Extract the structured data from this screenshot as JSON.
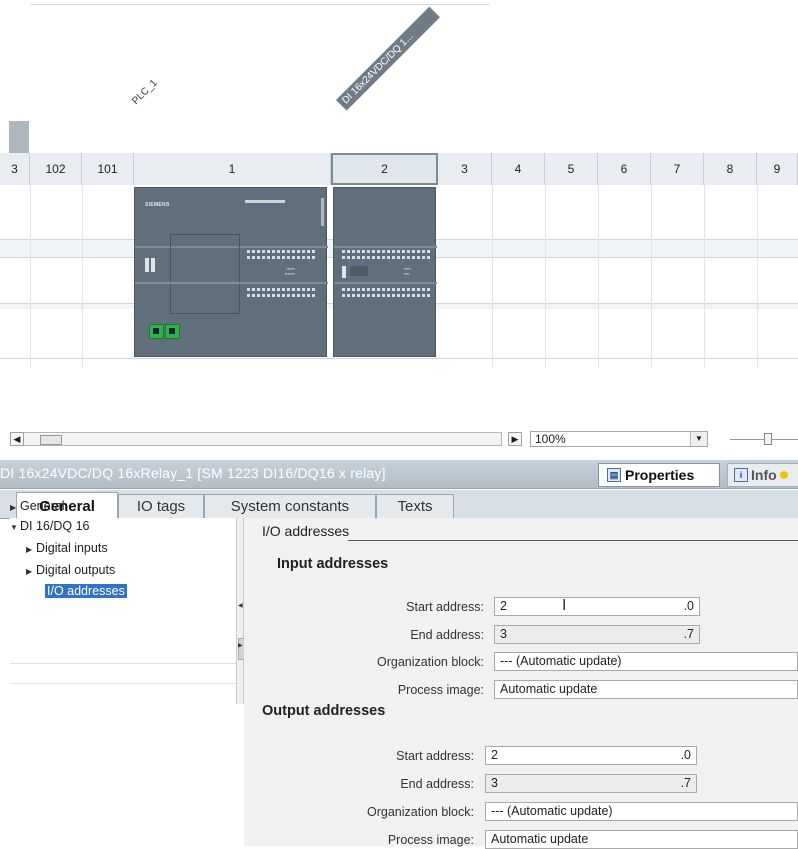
{
  "device_view": {
    "labels": {
      "plc": "PLC_1",
      "module": "DI 16x24VDC/DQ 1..."
    },
    "slots": [
      "3",
      "102",
      "101",
      "1",
      "2",
      "3",
      "4",
      "5",
      "6",
      "7",
      "8",
      "9"
    ],
    "selected_slot": "2"
  },
  "toolbar": {
    "zoom": "100%",
    "scroll_left_icon": "arrow-left-icon",
    "scroll_right_icon": "arrow-right-icon"
  },
  "inspector": {
    "title": "DI 16x24VDC/DQ 16xRelay_1 [SM 1223 DI16/DQ16 x relay]",
    "properties_tab": "Properties",
    "info_tab": "Info",
    "tabs": [
      "General",
      "IO tags",
      "System constants",
      "Texts"
    ],
    "active_tab": "General"
  },
  "tree": {
    "items": [
      {
        "label": "General",
        "level": 0,
        "expanded": false
      },
      {
        "label": "DI 16/DQ 16",
        "level": 0,
        "expanded": true
      },
      {
        "label": "Digital inputs",
        "level": 1,
        "expanded": false
      },
      {
        "label": "Digital outputs",
        "level": 1,
        "expanded": false
      },
      {
        "label": "I/O addresses",
        "level": 1,
        "selected": true
      }
    ]
  },
  "io": {
    "section_title": "I/O addresses",
    "input": {
      "title": "Input addresses",
      "start_label": "Start address:",
      "start_value": "2",
      "start_suffix": ".0",
      "end_label": "End address:",
      "end_value": "3",
      "end_suffix": ".7",
      "ob_label": "Organization block:",
      "ob_value": "--- (Automatic update)",
      "pi_label": "Process image:",
      "pi_value": "Automatic update"
    },
    "output": {
      "title": "Output addresses",
      "start_label": "Start address:",
      "start_value": "2",
      "start_suffix": ".0",
      "end_label": "End address:",
      "end_value": "3",
      "end_suffix": ".7",
      "ob_label": "Organization block:",
      "ob_value": "--- (Automatic update)",
      "pi_label": "Process image:",
      "pi_value": "Automatic update"
    }
  },
  "colors": {
    "accent": "#3272c8",
    "module": "#5f6f7b",
    "port": "#2fb14a"
  }
}
